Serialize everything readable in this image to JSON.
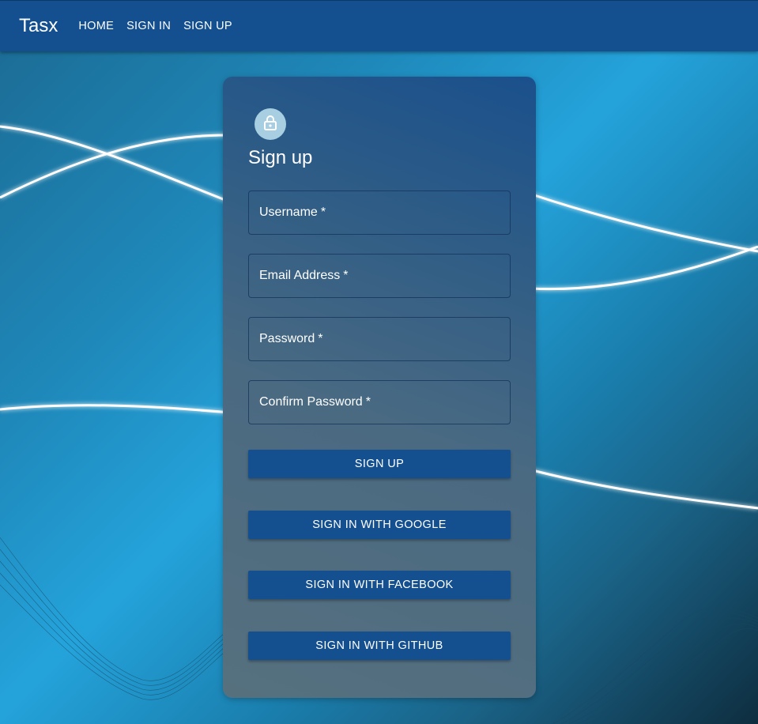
{
  "appbar": {
    "brand": "Tasx",
    "nav": [
      "HOME",
      "SIGN IN",
      "SIGN UP"
    ]
  },
  "form": {
    "title": "Sign up",
    "fields": [
      {
        "label": "Username",
        "required": "*"
      },
      {
        "label": "Email Address",
        "required": "*"
      },
      {
        "label": "Password",
        "required": "*"
      },
      {
        "label": "Confirm Password",
        "required": "*"
      }
    ],
    "buttons": [
      "SIGN UP",
      "SIGN IN WITH GOOGLE",
      "SIGN IN WITH FACEBOOK",
      "SIGN IN WITH GITHUB"
    ]
  },
  "icons": {
    "avatar": "lock-icon"
  },
  "colors": {
    "appbar": "#14508f",
    "button": "#14508f",
    "avatar": "#a7cfe1"
  }
}
